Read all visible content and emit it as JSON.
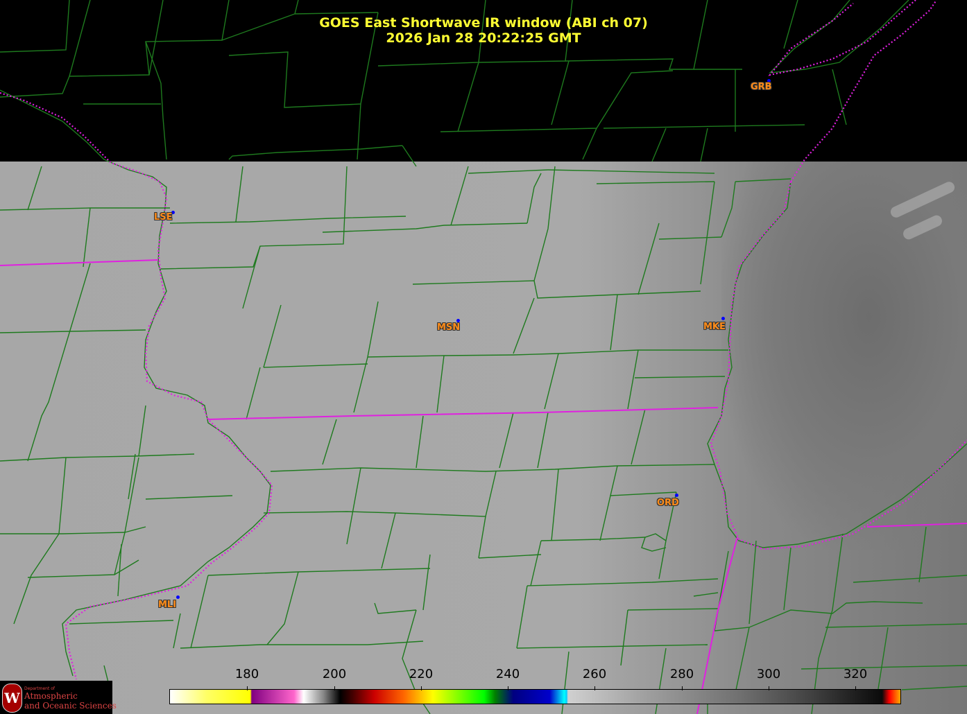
{
  "title": {
    "line1": "GOES East Shortwave IR window (ABI ch 07)",
    "line2": "2026 Jan 28  20:22:25 GMT"
  },
  "stations": [
    {
      "id": "GRB"
    },
    {
      "id": "LSE"
    },
    {
      "id": "MSN"
    },
    {
      "id": "MKE"
    },
    {
      "id": "ORD"
    },
    {
      "id": "MLI"
    }
  ],
  "colorbar": {
    "ticks": [
      "180",
      "200",
      "220",
      "240",
      "260",
      "280",
      "300",
      "320"
    ]
  },
  "logo": {
    "small_text": "Department of",
    "line1": "Atmospheric",
    "line2": "and Oceanic Sciences"
  },
  "colors": {
    "title": "#ffff33",
    "county_lines": "#1e7a1e",
    "state_lines": "#e020e0",
    "station_label": "#ff8c1a",
    "station_dot": "#0000ff"
  }
}
